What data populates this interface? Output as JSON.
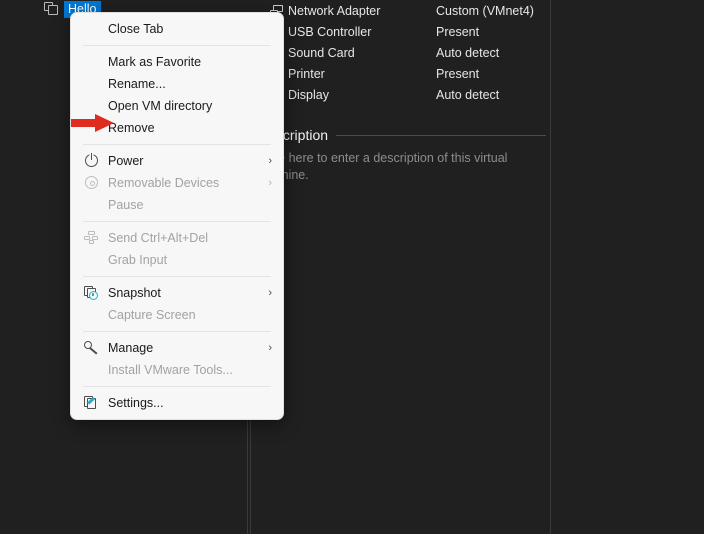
{
  "window": {
    "background_color": "#202020",
    "accent_color": "#0078d4"
  },
  "tab": {
    "icon": "vm-stack-icon",
    "label": "Hello",
    "selected": true
  },
  "devices": {
    "rows": [
      {
        "icon": "network-adapter-icon",
        "name": "Network Adapter",
        "value": "Custom (VMnet4)"
      },
      {
        "icon": "usb-controller-icon",
        "name": "USB Controller",
        "value": "Present"
      },
      {
        "icon": "sound-card-icon",
        "name": "Sound Card",
        "value": "Auto detect"
      },
      {
        "icon": "printer-icon",
        "name": "Printer",
        "value": "Present"
      },
      {
        "icon": "display-icon",
        "name": "Display",
        "value": "Auto detect"
      }
    ]
  },
  "description": {
    "heading": "Description",
    "placeholder": "Type here to enter a description of this virtual machine."
  },
  "context_menu": {
    "items": [
      {
        "id": "close-tab",
        "label": "Close Tab",
        "icon": null,
        "disabled": false,
        "submenu": false
      },
      {
        "id": "separator-1",
        "label": "",
        "icon": null,
        "disabled": false,
        "submenu": false,
        "separator": true
      },
      {
        "id": "mark-as-favorite",
        "label": "Mark as Favorite",
        "icon": null,
        "disabled": false,
        "submenu": false
      },
      {
        "id": "rename",
        "label": "Rename...",
        "icon": null,
        "disabled": false,
        "submenu": false
      },
      {
        "id": "open-vm-directory",
        "label": "Open VM directory",
        "icon": null,
        "disabled": false,
        "submenu": false
      },
      {
        "id": "remove",
        "label": "Remove",
        "icon": null,
        "disabled": false,
        "submenu": false
      },
      {
        "id": "separator-2",
        "label": "",
        "icon": null,
        "disabled": false,
        "submenu": false,
        "separator": true
      },
      {
        "id": "power",
        "label": "Power",
        "icon": "power-icon",
        "disabled": false,
        "submenu": true
      },
      {
        "id": "removable-devices",
        "label": "Removable Devices",
        "icon": "disc-icon",
        "disabled": true,
        "submenu": true
      },
      {
        "id": "pause",
        "label": "Pause",
        "icon": null,
        "disabled": true,
        "submenu": false
      },
      {
        "id": "separator-3",
        "label": "",
        "icon": null,
        "disabled": false,
        "submenu": false,
        "separator": true
      },
      {
        "id": "send-ctrl-alt-del",
        "label": "Send Ctrl+Alt+Del",
        "icon": "keyboard-icon",
        "disabled": true,
        "submenu": false
      },
      {
        "id": "grab-input",
        "label": "Grab Input",
        "icon": null,
        "disabled": true,
        "submenu": false
      },
      {
        "id": "separator-4",
        "label": "",
        "icon": null,
        "disabled": false,
        "submenu": false,
        "separator": true
      },
      {
        "id": "snapshot",
        "label": "Snapshot",
        "icon": "snapshot-clock-icon",
        "disabled": false,
        "submenu": true
      },
      {
        "id": "capture-screen",
        "label": "Capture Screen",
        "icon": null,
        "disabled": true,
        "submenu": false
      },
      {
        "id": "separator-5",
        "label": "",
        "icon": null,
        "disabled": false,
        "submenu": false,
        "separator": true
      },
      {
        "id": "manage",
        "label": "Manage",
        "icon": "wrench-icon",
        "disabled": false,
        "submenu": true
      },
      {
        "id": "install-vmware-tools",
        "label": "Install VMware Tools...",
        "icon": null,
        "disabled": true,
        "submenu": false
      },
      {
        "id": "separator-6",
        "label": "",
        "icon": null,
        "disabled": false,
        "submenu": false,
        "separator": true
      },
      {
        "id": "settings",
        "label": "Settings...",
        "icon": "settings-pencil-icon",
        "disabled": false,
        "submenu": false
      }
    ],
    "submenu_arrow_glyph": "›"
  },
  "annotation": {
    "arrow": "red-right-arrow",
    "color": "#e02b20",
    "points_at": "Remove"
  }
}
